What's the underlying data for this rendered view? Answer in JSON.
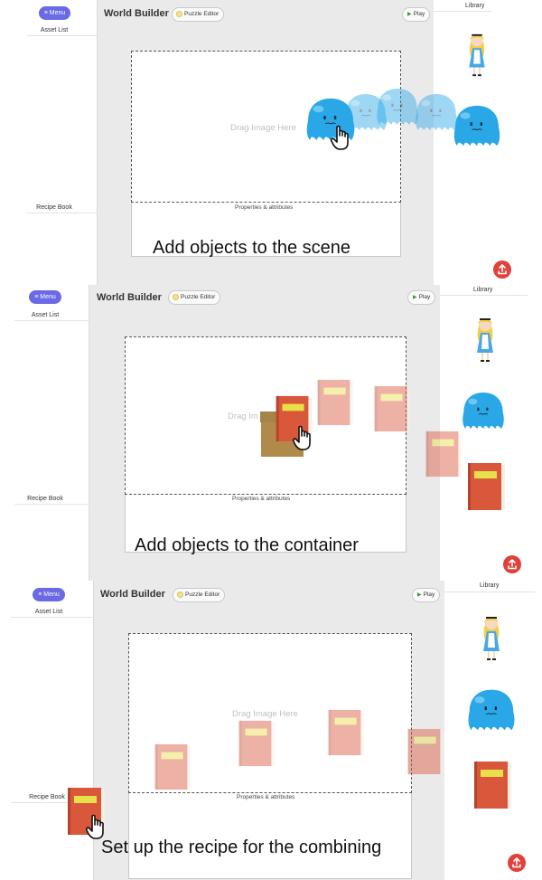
{
  "panels": [
    {
      "menu_label": "≡ Menu",
      "asset_list_label": "Asset List",
      "recipe_book_label": "Recipe Book",
      "app_title": "World Builder",
      "editor_chip_label": "Puzzle Editor",
      "play_label": "Play",
      "dropzone_hint": "Drag Image Here",
      "properties_label": "Properties & attributes",
      "caption": "Add objects to the scene",
      "library_label": "Library"
    },
    {
      "menu_label": "≡ Menu",
      "asset_list_label": "Asset List",
      "recipe_book_label": "Recipe Book",
      "app_title": "World Builder",
      "editor_chip_label": "Puzzle Editor",
      "play_label": "Play",
      "dropzone_hint": "Drag Im",
      "properties_label": "Properties & attributes",
      "caption": "Add objects to the container",
      "library_label": "Library"
    },
    {
      "menu_label": "≡ Menu",
      "asset_list_label": "Asset List",
      "recipe_book_label": "Recipe Book",
      "app_title": "World Builder",
      "editor_chip_label": "Puzzle Editor",
      "play_label": "Play",
      "dropzone_hint": "Drag Image Here",
      "properties_label": "Properties & attributes",
      "caption": "Set up the recipe for the combining",
      "library_label": "Library"
    }
  ],
  "icons": {
    "play": "play-triangle-icon",
    "upload": "upload-icon",
    "hand_cursor": "hand-pointer-icon",
    "editor_chip": "puzzle-dot-icon"
  },
  "colors": {
    "menu_button": "#6a6ae6",
    "upload_button": "#e0413a",
    "blob": "#2aa7e6",
    "book": "#d9573a",
    "book_label": "#e8e04a",
    "box": "#b08a4a"
  }
}
